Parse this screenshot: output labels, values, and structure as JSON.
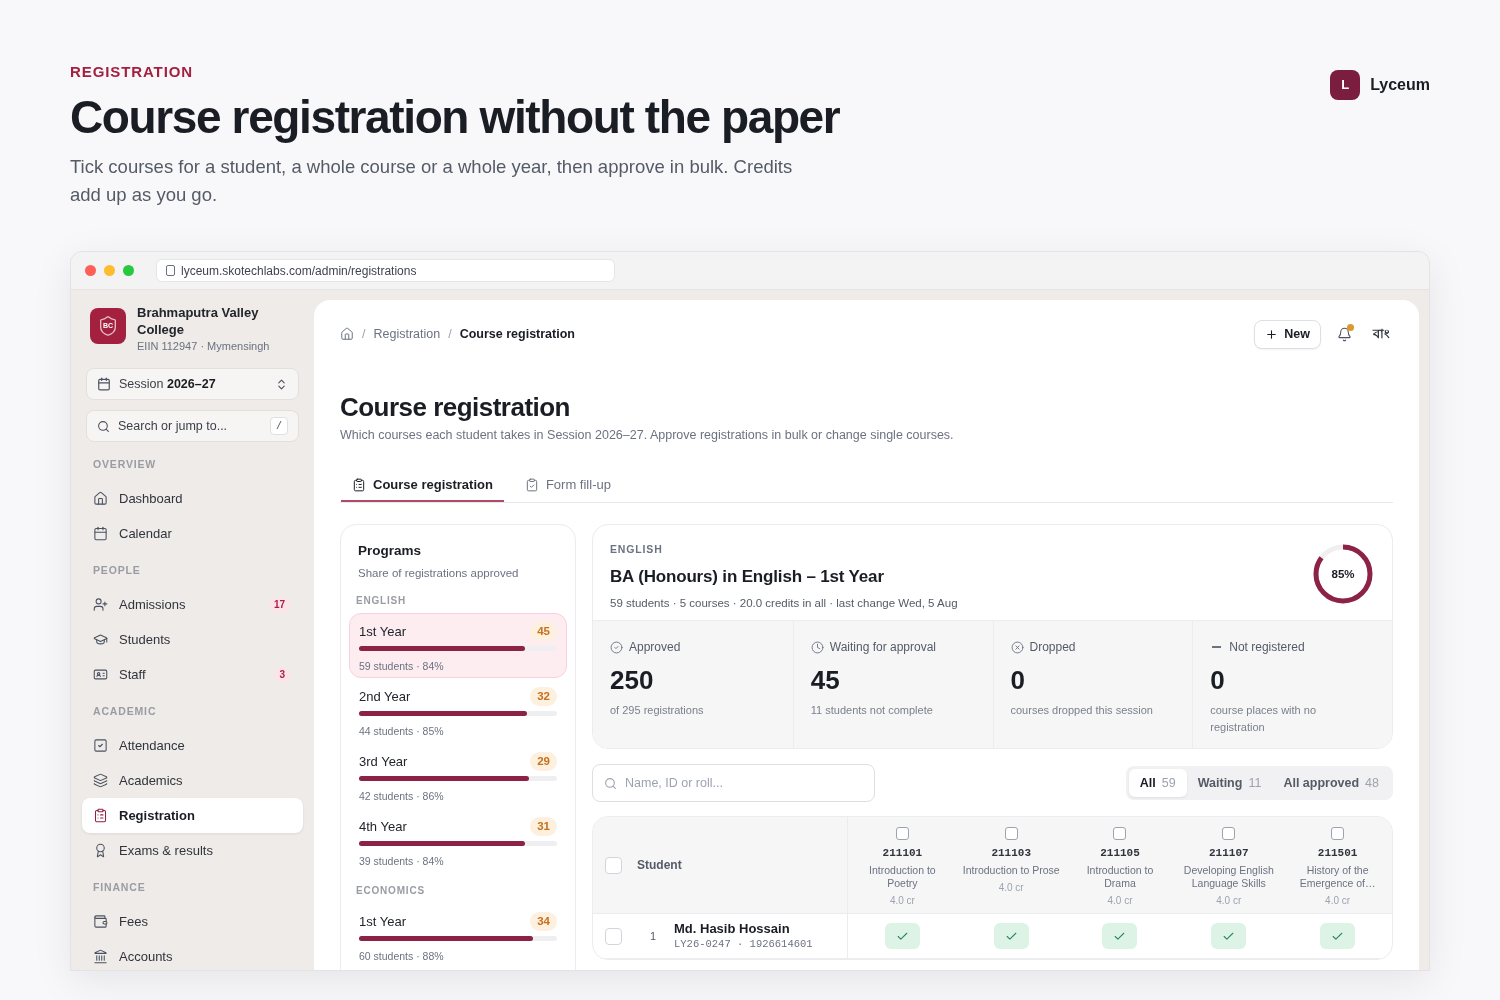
{
  "header": {
    "eyebrow": "REGISTRATION",
    "title": "Course registration without the paper",
    "lead": "Tick courses for a student, a whole course or a whole year, then approve in bulk. Credits add up as you go.",
    "brand": {
      "mark": "L",
      "name": "Lyceum"
    }
  },
  "browser": {
    "url": "lyceum.skotechlabs.com/admin/registrations"
  },
  "sidebar": {
    "college": {
      "mark": "BC",
      "name": "Brahmaputra Valley College",
      "meta": "EIIN 112947 · Mymensingh"
    },
    "session": {
      "label": "Session",
      "value": "2026–27"
    },
    "search": {
      "placeholder": "Search or jump to...",
      "shortcut": "/"
    },
    "sections": [
      {
        "title": "OVERVIEW",
        "items": [
          {
            "label": "Dashboard",
            "selected": false
          },
          {
            "label": "Calendar",
            "selected": false
          }
        ]
      },
      {
        "title": "PEOPLE",
        "items": [
          {
            "label": "Admissions",
            "badge": "17",
            "selected": false
          },
          {
            "label": "Students",
            "selected": false
          },
          {
            "label": "Staff",
            "badge": "3",
            "selected": false
          }
        ]
      },
      {
        "title": "ACADEMIC",
        "items": [
          {
            "label": "Attendance",
            "selected": false
          },
          {
            "label": "Academics",
            "selected": false
          },
          {
            "label": "Registration",
            "selected": true
          },
          {
            "label": "Exams & results",
            "selected": false
          }
        ]
      },
      {
        "title": "FINANCE",
        "items": [
          {
            "label": "Fees",
            "selected": false
          },
          {
            "label": "Accounts",
            "selected": false
          }
        ]
      }
    ]
  },
  "topbar": {
    "separator": "/",
    "breadcrumb": [
      "Registration",
      "Course registration"
    ],
    "new_button": "New",
    "notification_dot": true,
    "language": "বাং"
  },
  "page": {
    "title": "Course registration",
    "description": "Which courses each student takes in Session 2026–27. Approve registrations in bulk or change single courses.",
    "tabs": [
      {
        "label": "Course registration",
        "selected": true
      },
      {
        "label": "Form fill-up",
        "selected": false
      }
    ]
  },
  "programs": {
    "title": "Programs",
    "subtitle": "Share of registrations approved",
    "groups": [
      {
        "name": "ENGLISH",
        "items": [
          {
            "label": "1st Year",
            "count": "45",
            "level": 0.84,
            "meta": "59 students · 84%",
            "selected": true
          },
          {
            "label": "2nd Year",
            "count": "32",
            "level": 0.85,
            "meta": "44 students · 85%",
            "selected": false
          },
          {
            "label": "3rd Year",
            "count": "29",
            "level": 0.86,
            "meta": "42 students · 86%",
            "selected": false
          },
          {
            "label": "4th Year",
            "count": "31",
            "level": 0.84,
            "meta": "39 students · 84%",
            "selected": false
          }
        ]
      },
      {
        "name": "ECONOMICS",
        "items": [
          {
            "label": "1st Year",
            "count": "34",
            "level": 0.88,
            "meta": "60 students · 88%",
            "selected": false
          }
        ]
      }
    ]
  },
  "summary": {
    "eyebrow": "ENGLISH",
    "title": "BA (Honours) in English – 1st Year",
    "meta": "59 students · 5 courses · 20.0 credits in all · last change Wed, 5 Aug",
    "donut": {
      "level": 0.85,
      "label": "85%"
    },
    "stats": [
      {
        "label": "Approved",
        "value": "250",
        "note": "of 295 registrations"
      },
      {
        "label": "Waiting for approval",
        "value": "45",
        "note": "11 students not complete"
      },
      {
        "label": "Dropped",
        "value": "0",
        "note": "courses dropped this session"
      },
      {
        "label": "Not registered",
        "value": "0",
        "note": "course places with no registration"
      }
    ]
  },
  "filter": {
    "placeholder": "Name, ID or roll...",
    "options": [
      {
        "label": "All",
        "count": "59",
        "selected": true
      },
      {
        "label": "Waiting",
        "count": "11",
        "selected": false
      },
      {
        "label": "All approved",
        "count": "48",
        "selected": false
      }
    ]
  },
  "table": {
    "student_header": "Student",
    "select_all_checked": false,
    "columns": [
      {
        "code": "211101",
        "title": "Introduction to Poetry",
        "credits": "4.0 cr",
        "checked": false
      },
      {
        "code": "211103",
        "title": "Introduction to Prose",
        "credits": "4.0 cr",
        "checked": false
      },
      {
        "code": "211105",
        "title": "Introduction to Drama",
        "credits": "4.0 cr",
        "checked": false
      },
      {
        "code": "211107",
        "title": "Developing English Language Skills",
        "credits": "4.0 cr",
        "checked": false
      },
      {
        "code": "211501",
        "title": "History of the Emergence of…",
        "credits": "4.0 cr",
        "checked": false
      }
    ],
    "rows": [
      {
        "index": "1",
        "name": "Md. Hasib Hossain",
        "id": "LY26-0247 · 1926614601",
        "checked": false,
        "cells": [
          {
            "kind": "approved"
          },
          {
            "kind": "approved"
          },
          {
            "kind": "approved"
          },
          {
            "kind": "approved"
          },
          {
            "kind": "approved"
          }
        ]
      }
    ]
  }
}
